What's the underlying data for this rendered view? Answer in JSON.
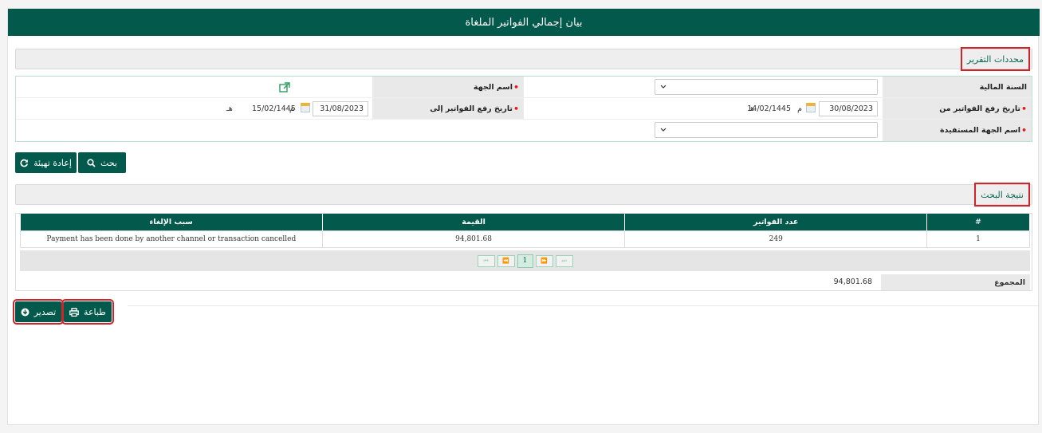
{
  "page": {
    "title": "بيان إجمالي الفواتير الملغاة"
  },
  "criteria": {
    "section_title": "محددات التقرير",
    "fiscal_year_label": "السنة المالية",
    "fiscal_year_value": "",
    "entity_name_label": "اسم الجهة",
    "date_from_label": "تاريخ رفع الفواتير من",
    "date_from_greg": "30/08/2023",
    "date_from_greg_suffix": "م",
    "date_from_hijri": "14/02/1445",
    "date_from_hijri_suffix": "هـ",
    "date_to_label": "تاريخ رفع الفواتير إلى",
    "date_to_greg": "31/08/2023",
    "date_to_greg_suffix": "م",
    "date_to_hijri": "15/02/1445",
    "date_to_hijri_suffix": "هـ",
    "beneficiary_label": "اسم الجهة المستفيدة",
    "beneficiary_value": ""
  },
  "buttons": {
    "search": "بحث",
    "reset": "إعادة تهيئة",
    "print": "طباعة",
    "export": "تصدير"
  },
  "results": {
    "section_title": "نتيجة البحث",
    "columns": {
      "index": "#",
      "invoice_count": "عدد الفواتير",
      "amount": "القيمة",
      "reason": "سبب الإلغاء"
    },
    "rows": [
      {
        "index": "1",
        "invoice_count": "249",
        "amount": "94,801.68",
        "reason": "Payment has been done by another channel or transaction cancelled"
      }
    ],
    "pager": {
      "first": "⏮",
      "prev": "⏪",
      "page": "1",
      "next": "⏩",
      "last": "⏭"
    },
    "total_label": "المجموع",
    "total_value": "94,801.68"
  },
  "colors": {
    "primary": "#035a4c",
    "highlight": "#d2232a",
    "required": "#e02020"
  },
  "icons": {
    "external": "external-link-icon",
    "search": "search-icon",
    "reset": "refresh-icon",
    "print": "print-icon",
    "export": "download-icon",
    "calendar": "calendar-icon"
  }
}
